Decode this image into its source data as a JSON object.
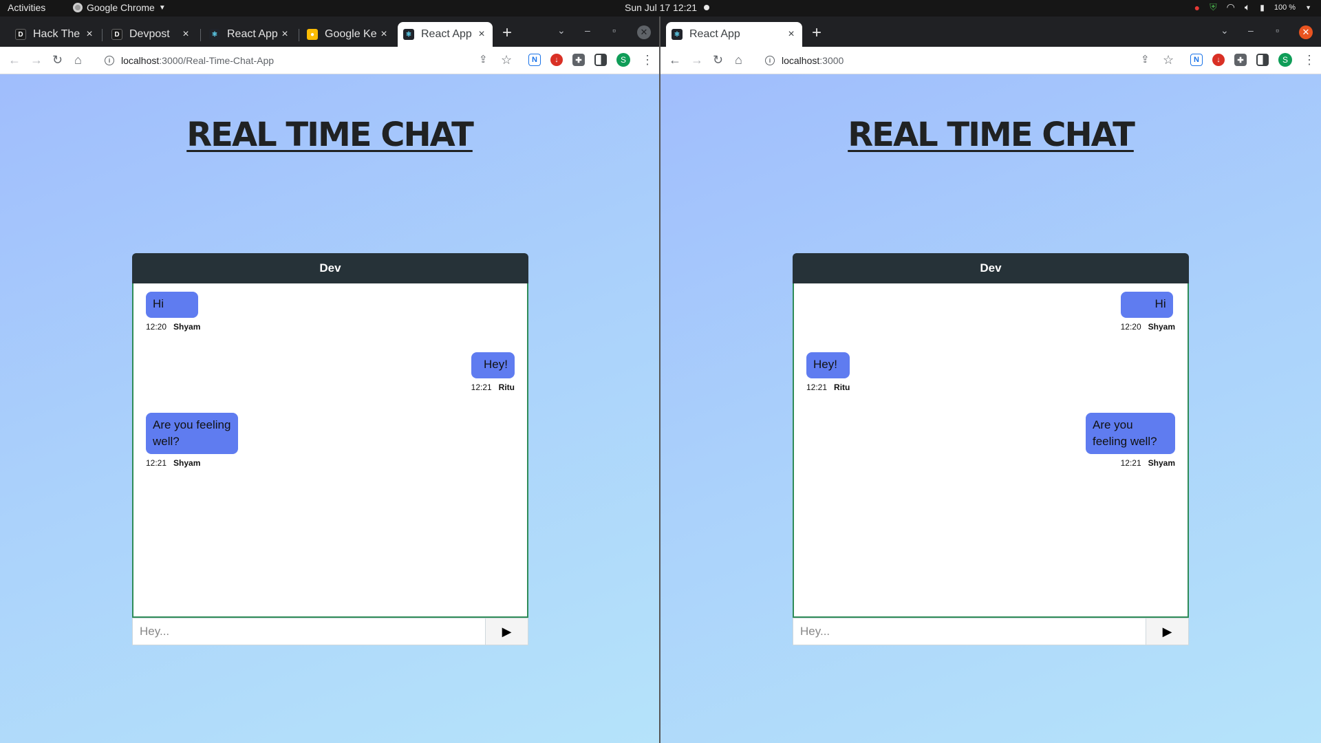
{
  "system": {
    "activities": "Activities",
    "app_name": "Google Chrome",
    "clock": "Sun Jul 17  12:21",
    "battery": "100 %"
  },
  "left_window": {
    "tabs": [
      {
        "label": "Hack The F",
        "favicon": "dev-icon"
      },
      {
        "label": "Devpost",
        "favicon": "dev-icon"
      },
      {
        "label": "React App",
        "favicon": "react-icon"
      },
      {
        "label": "Google Ke",
        "favicon": "keep-icon"
      },
      {
        "label": "React App",
        "favicon": "react-icon"
      }
    ],
    "url_host": "localhost",
    "url_path": ":3000/Real-Time-Chat-App",
    "avatar": "S"
  },
  "right_window": {
    "tabs": [
      {
        "label": "React App",
        "favicon": "react-icon"
      }
    ],
    "url_host": "localhost",
    "url_path": ":3000",
    "avatar": "S"
  },
  "page": {
    "title": "REAL TIME CHAT",
    "room": "Dev",
    "input_placeholder": "Hey...",
    "send_symbol": "▶"
  },
  "left_messages": [
    {
      "text": "Hi",
      "time": "12:20",
      "author": "Shyam"
    },
    {
      "text": "Hey!",
      "time": "12:21",
      "author": "Ritu"
    },
    {
      "text": "Are you feeling well?",
      "time": "12:21",
      "author": "Shyam"
    }
  ],
  "right_messages": [
    {
      "text": "Hi",
      "time": "12:20",
      "author": "Shyam"
    },
    {
      "text": "Hey!",
      "time": "12:21",
      "author": "Ritu"
    },
    {
      "text": "Are you feeling well?",
      "time": "12:21",
      "author": "Shyam"
    }
  ],
  "colors": {
    "bubble": "#5f7cf0",
    "header": "#263238",
    "border": "#2e8b57"
  }
}
